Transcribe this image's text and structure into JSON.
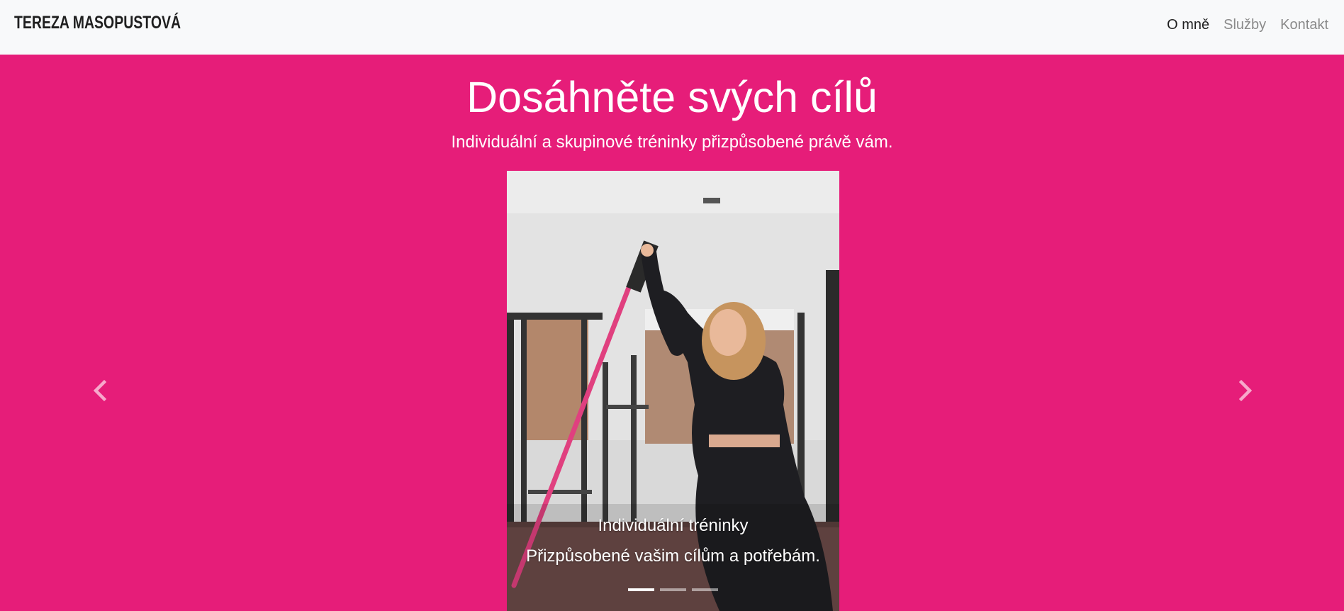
{
  "header": {
    "brand": "TEREZA MASOPUSTOVÁ",
    "nav": [
      {
        "label": "O mně",
        "active": true
      },
      {
        "label": "Služby",
        "active": false
      },
      {
        "label": "Kontakt",
        "active": false
      }
    ]
  },
  "hero": {
    "title": "Dosáhněte svých cílů",
    "subtitle": "Individuální a skupinové tréninky přizpůsobené právě vám."
  },
  "carousel": {
    "active_index": 0,
    "slide_count": 3,
    "caption_title": "Individuální tréninky",
    "caption_text": "Přizpůsobené vašim cílům a potřebám.",
    "prev_icon": "chevron-left-icon",
    "next_icon": "chevron-right-icon"
  },
  "colors": {
    "hero_background": "#e61d79",
    "navbar_background": "#f8f9fa",
    "nav_active": "#1f1f1f",
    "nav_inactive": "#8a8a8a"
  }
}
